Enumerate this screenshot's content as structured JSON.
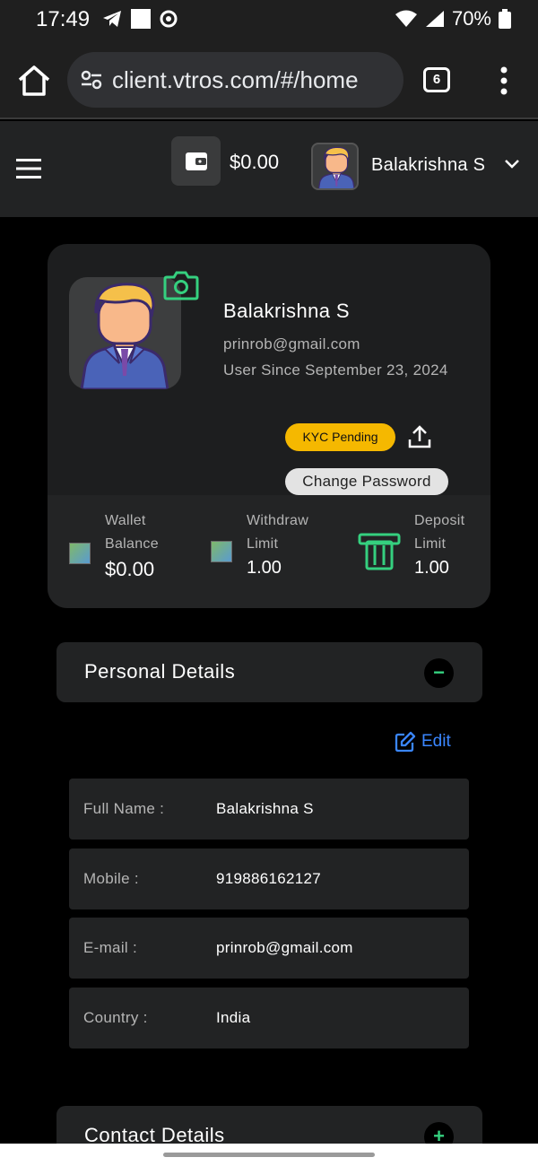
{
  "status_bar": {
    "time": "17:49",
    "battery": "70%"
  },
  "browser": {
    "url": "client.vtros.com/#/home",
    "tab_count": "6"
  },
  "app_header": {
    "balance": "$0.00",
    "username": "Balakrishna S"
  },
  "profile": {
    "name": "Balakrishna S",
    "email": "prinrob@gmail.com",
    "user_since": "User Since September 23, 2024",
    "kyc_status": "KYC Pending",
    "change_password_label": "Change Password",
    "stats": [
      {
        "label": "Wallet Balance",
        "value": "$0.00"
      },
      {
        "label": "Withdraw Limit",
        "value": "1.00"
      },
      {
        "label": "Deposit Limit",
        "value": "1.00"
      }
    ]
  },
  "personal_details": {
    "title": "Personal Details",
    "toggle": "−",
    "edit_label": "Edit",
    "rows": [
      {
        "label": "Full Name :",
        "value": "Balakrishna S"
      },
      {
        "label": "Mobile :",
        "value": "919886162127"
      },
      {
        "label": "E-mail :",
        "value": "prinrob@gmail.com"
      },
      {
        "label": "Country :",
        "value": "India"
      }
    ]
  },
  "contact_details": {
    "title": "Contact Details",
    "toggle": "+"
  },
  "colors": {
    "accent_green": "#35d07f",
    "kyc_badge": "#f5b800",
    "link_blue": "#3a86ff"
  }
}
